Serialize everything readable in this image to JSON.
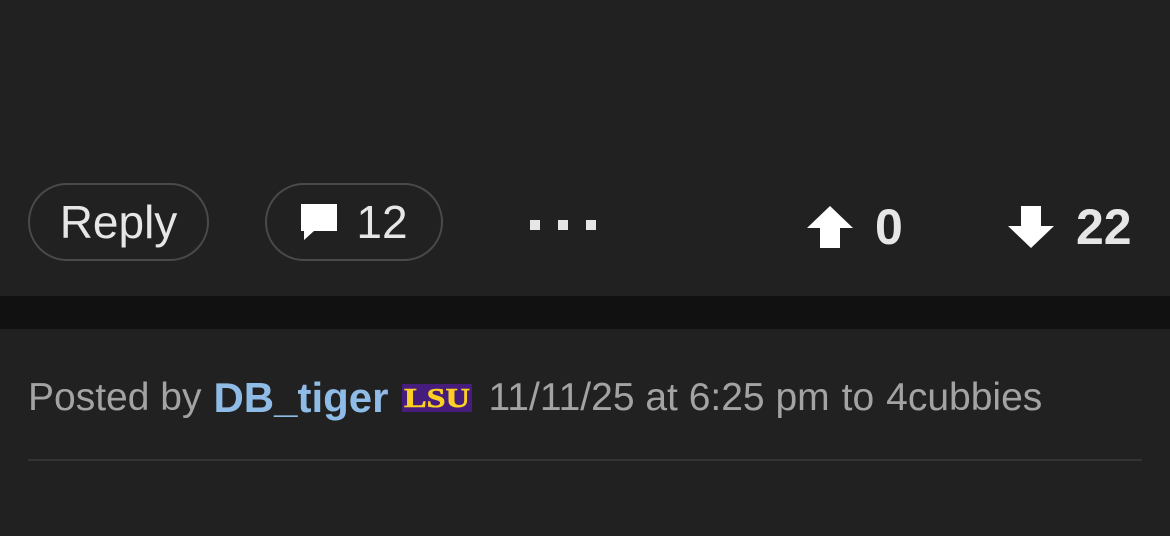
{
  "post_actions": {
    "reply_label": "Reply",
    "comment_count": "12",
    "more_label": "...",
    "upvotes": "0",
    "downvotes": "22"
  },
  "post_meta": {
    "posted_by_label": "Posted by",
    "author": "DB_tiger",
    "team_logo_text": "LSU",
    "timestamp": "11/11/25 at 6:25 pm",
    "to_label": "to",
    "recipient": "4cubbies"
  },
  "colors": {
    "background": "#212121",
    "divider": "#111111",
    "author_link": "#8fbce6",
    "meta_text": "#a3a3a3",
    "lsu_purple": "#461d7c",
    "lsu_gold": "#fdd023"
  }
}
